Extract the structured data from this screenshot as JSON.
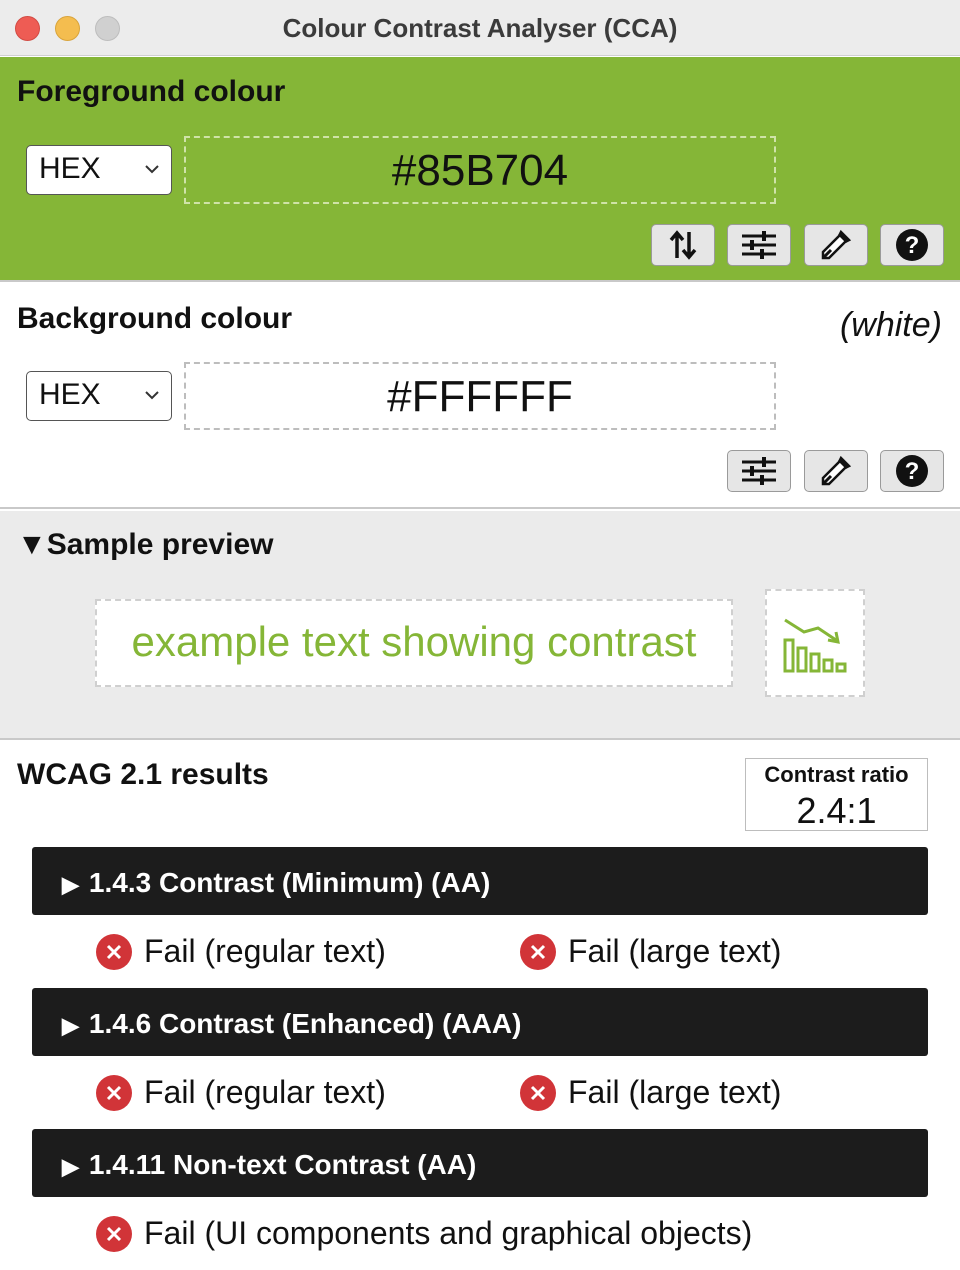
{
  "window": {
    "title": "Colour Contrast Analyser (CCA)"
  },
  "foreground": {
    "heading": "Foreground colour",
    "format": "HEX",
    "value": "#85B704",
    "swatch_color": "#85B637"
  },
  "background": {
    "heading": "Background colour",
    "colour_name": "(white)",
    "format": "HEX",
    "value": "#FFFFFF"
  },
  "preview": {
    "heading": "Sample preview",
    "sample_text": "example text showing contrast"
  },
  "results": {
    "heading": "WCAG 2.1 results",
    "contrast_ratio_label": "Contrast ratio",
    "contrast_ratio_value": "2.4:1",
    "criteria": [
      {
        "title": "1.4.3 Contrast (Minimum) (AA)",
        "regular": "Fail (regular text)",
        "large": "Fail (large text)"
      },
      {
        "title": "1.4.6 Contrast (Enhanced) (AAA)",
        "regular": "Fail (regular text)",
        "large": "Fail (large text)"
      },
      {
        "title": "1.4.11 Non-text Contrast (AA)",
        "ui": "Fail (UI components and graphical objects)"
      }
    ]
  },
  "icons": {
    "swap": "swap-icon",
    "sliders": "sliders-icon",
    "eyedropper": "eyedropper-icon",
    "help": "help-icon",
    "fail": "fail-icon",
    "chart": "chart-icon"
  }
}
